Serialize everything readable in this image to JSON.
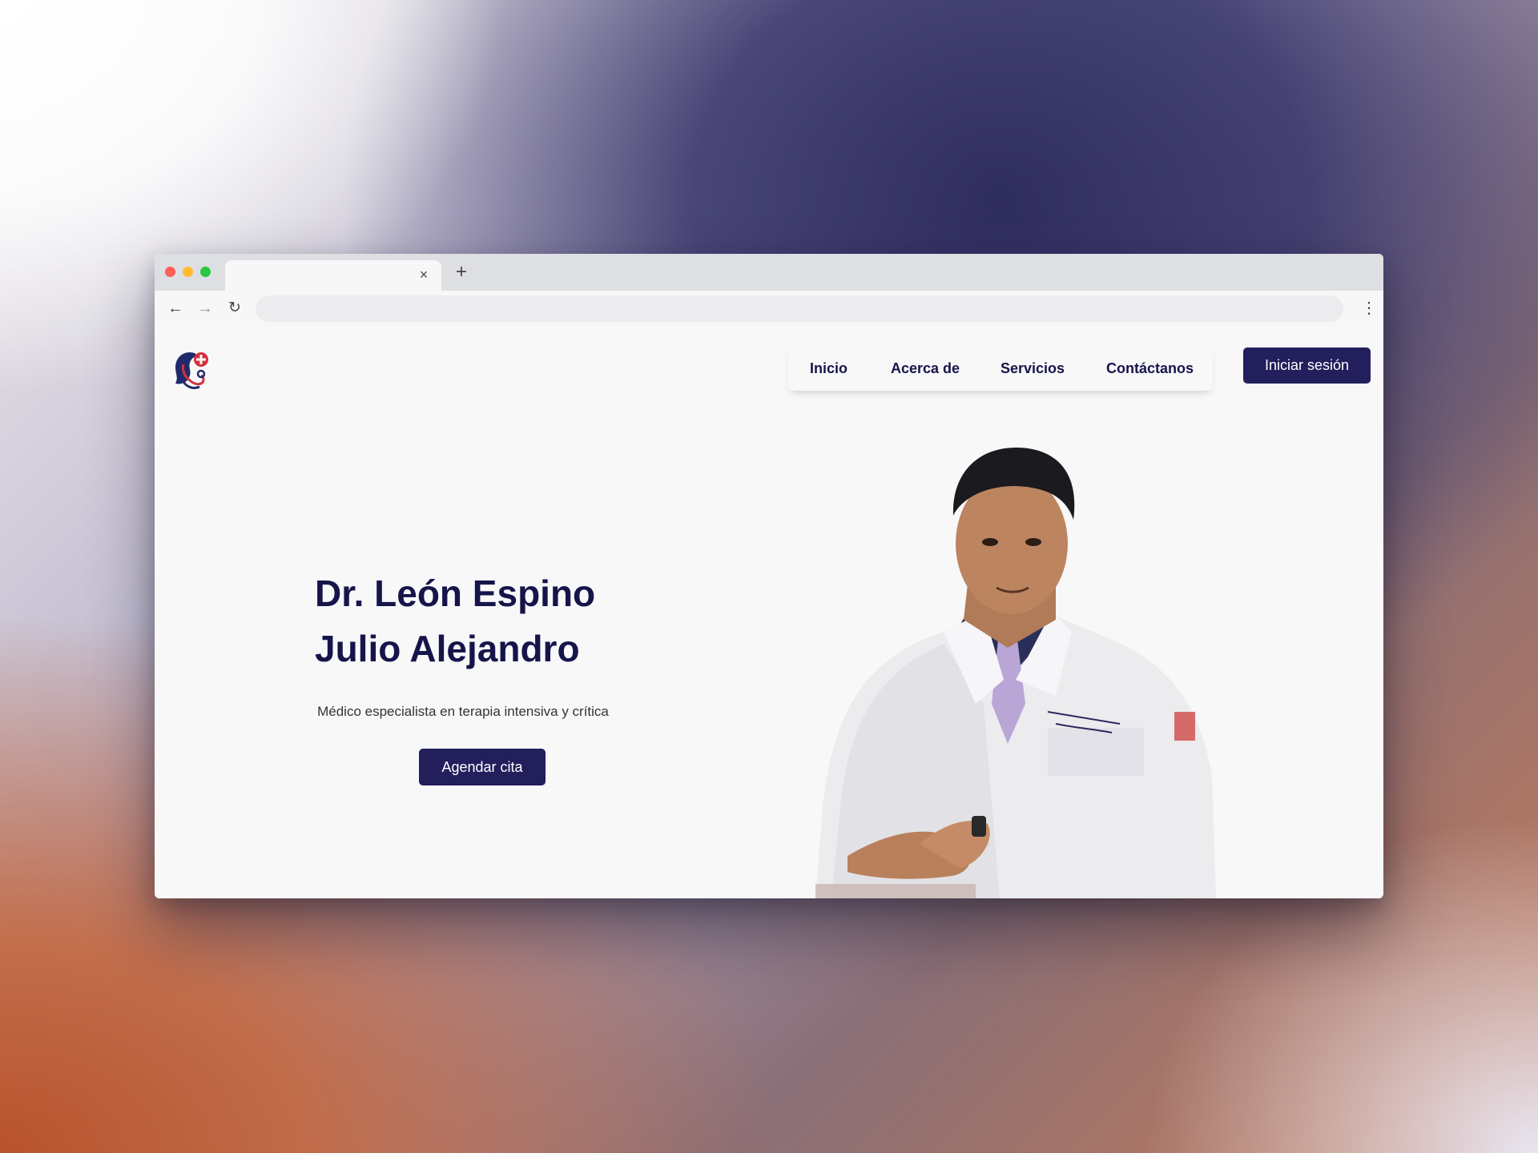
{
  "browser": {
    "tab_close": "×",
    "new_tab": "+",
    "back": "←",
    "forward": "→",
    "reload": "↻",
    "menu": "⋮"
  },
  "nav": {
    "items": [
      {
        "label": "Inicio"
      },
      {
        "label": "Acerca de"
      },
      {
        "label": "Servicios"
      },
      {
        "label": "Contáctanos"
      }
    ],
    "login_label": "Iniciar sesión"
  },
  "hero": {
    "title_line1": "Dr. León Espino",
    "title_line2": "Julio Alejandro",
    "subtitle": "Médico especialista en terapia intensiva y crítica",
    "cta_label": "Agendar cita"
  },
  "colors": {
    "brand": "#221f5c",
    "title": "#16154a",
    "logo_red": "#d62f3a"
  }
}
